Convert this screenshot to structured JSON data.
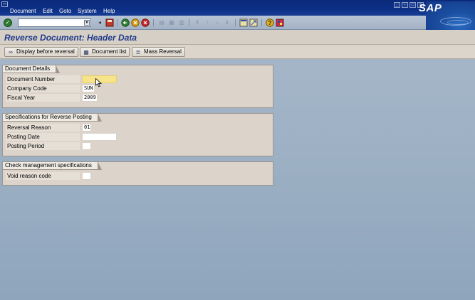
{
  "menu": {
    "items": [
      "Document",
      "Edit",
      "Goto",
      "System",
      "Help"
    ]
  },
  "brand": {
    "logo_text": "SAP"
  },
  "toolbar": {
    "command_field_value": ""
  },
  "title": "Reverse Document: Header Data",
  "app_toolbar": {
    "display_before_reversal": "Display before reversal",
    "document_list": "Document list",
    "mass_reversal": "Mass Reversal"
  },
  "sections": {
    "document_details": {
      "title": "Document Details",
      "fields": [
        {
          "label": "Document Number",
          "value": ""
        },
        {
          "label": "Company Code",
          "value": "SUN"
        },
        {
          "label": "Fiscal Year",
          "value": "2009"
        }
      ]
    },
    "reverse_posting": {
      "title": "Specifications for Reverse Posting",
      "fields": [
        {
          "label": "Reversal Reason",
          "value": "01"
        },
        {
          "label": "Posting Date",
          "value": ""
        },
        {
          "label": "Posting Period",
          "value": ""
        }
      ]
    },
    "check_management": {
      "title": "Check management specifications",
      "fields": [
        {
          "label": "Void reason code",
          "value": ""
        }
      ]
    }
  },
  "colors": {
    "menubar": "#0c2f86",
    "title_text": "#1f3a8a",
    "frame_bg": "#dcd4ca",
    "required_field": "#f7e38a",
    "background": "#9fb2c5"
  }
}
